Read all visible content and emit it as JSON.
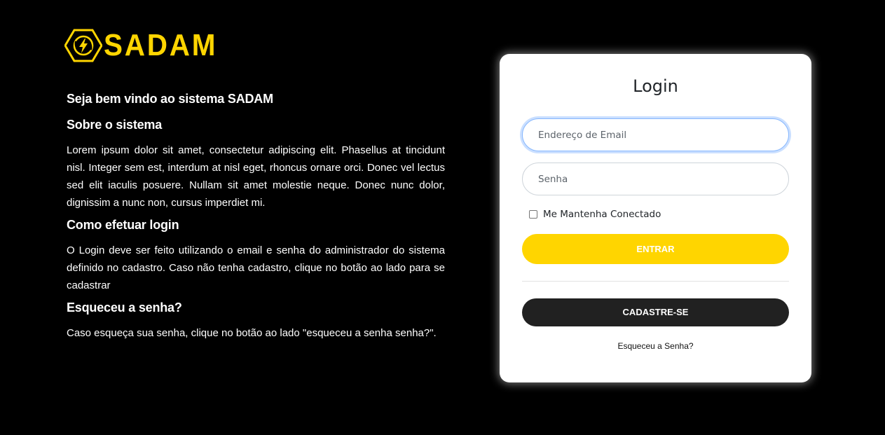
{
  "brand": {
    "name": "SADAM",
    "icon": "lightning-hexagon-icon",
    "color": "#ffd500"
  },
  "intro": {
    "welcome": "Seja bem vindo ao sistema SADAM",
    "about_title": "Sobre o sistema",
    "about_text": "Lorem ipsum dolor sit amet, consectetur adipiscing elit. Phasellus at tincidunt nisl. Integer sem est, interdum at nisl eget, rhoncus ornare orci. Donec vel lectus sed elit iaculis posuere. Nullam sit amet molestie neque. Donec nunc dolor, dignissim a nunc non, cursus imperdiet mi.",
    "howto_title": "Como efetuar login",
    "howto_text": "O Login deve ser feito utilizando o email e senha do administrador do sistema definido no cadastro. Caso não tenha cadastro, clique no botão ao lado para se cadastrar",
    "forgot_title": "Esqueceu a senha?",
    "forgot_text": "Caso esqueça sua senha, clique no botão ao lado \"esqueceu a senha senha?\"."
  },
  "login": {
    "title": "Login",
    "email_value": "",
    "email_placeholder": "Endereço de Email",
    "password_value": "",
    "password_placeholder": "Senha",
    "remember_label": "Me Mantenha Conectado",
    "remember_checked": false,
    "submit_label": "ENTRAR",
    "register_label": "CADASTRE-SE",
    "forgot_label": "Esqueceu a Senha?"
  },
  "colors": {
    "background": "#000000",
    "accent": "#ffd500",
    "dark_button": "#212121",
    "card": "#ffffff"
  }
}
